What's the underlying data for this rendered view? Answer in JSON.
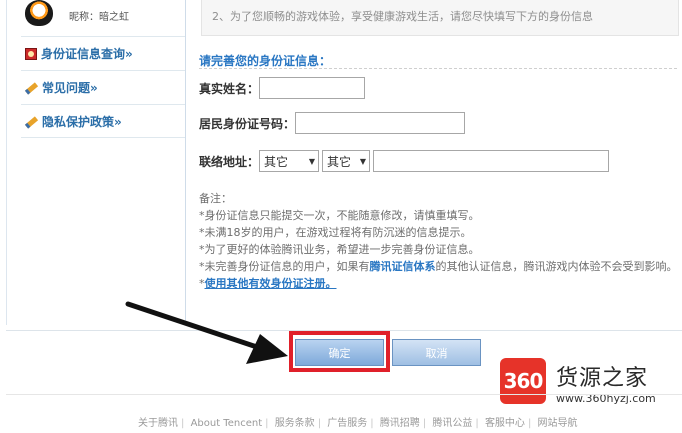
{
  "user": {
    "nickname": "昵称：暗之虹"
  },
  "sidebar": {
    "items": [
      {
        "label": "身份证信息查询»",
        "icon": "id-card-icon"
      },
      {
        "label": "常见问题»",
        "icon": "pencil-icon"
      },
      {
        "label": "隐私保护政策»",
        "icon": "pencil-icon"
      }
    ]
  },
  "notice": {
    "text": "2、为了您顺畅的游戏体验，享受健康游戏生活，请您尽快填写下方的身份信息"
  },
  "form": {
    "title": "请完善您的身份证信息：",
    "name_label": "真实姓名：",
    "name_value": "",
    "id_label": "居民身份证号码：",
    "id_value": "",
    "address_label": "联络地址：",
    "province_value": "其它",
    "city_value": "其它",
    "address_value": ""
  },
  "notes": {
    "heading": "备注：",
    "line1": "*身份证信息只能提交一次，不能随意修改，请慎重填写。",
    "line2": "*未满18岁的用户，在游戏过程将有防沉迷的信息提示。",
    "line3": "*为了更好的体验腾讯业务，希望进一步完善身份证信息。",
    "line4_pre": "*未完善身份证信息的用户，如果有",
    "line4_link": "腾讯证信体系",
    "line4_post": "的其他认证信息，腾讯游戏内体验不会受到影响。",
    "line5_prefix": "*",
    "line5_link": "使用其他有效身份证注册。"
  },
  "buttons": {
    "confirm": "确定",
    "cancel": "取消"
  },
  "watermark": {
    "logo": "360",
    "name": "货源之家",
    "url": "www.360hyzj.com"
  },
  "footer": {
    "links": [
      "关于腾讯",
      "About Tencent",
      "服务条款",
      "广告服务",
      "腾讯招聘",
      "腾讯公益",
      "客服中心",
      "网站导航"
    ]
  },
  "colors": {
    "accent": "#2a77c3",
    "highlight": "#e0202a",
    "brand": "#e63329"
  }
}
